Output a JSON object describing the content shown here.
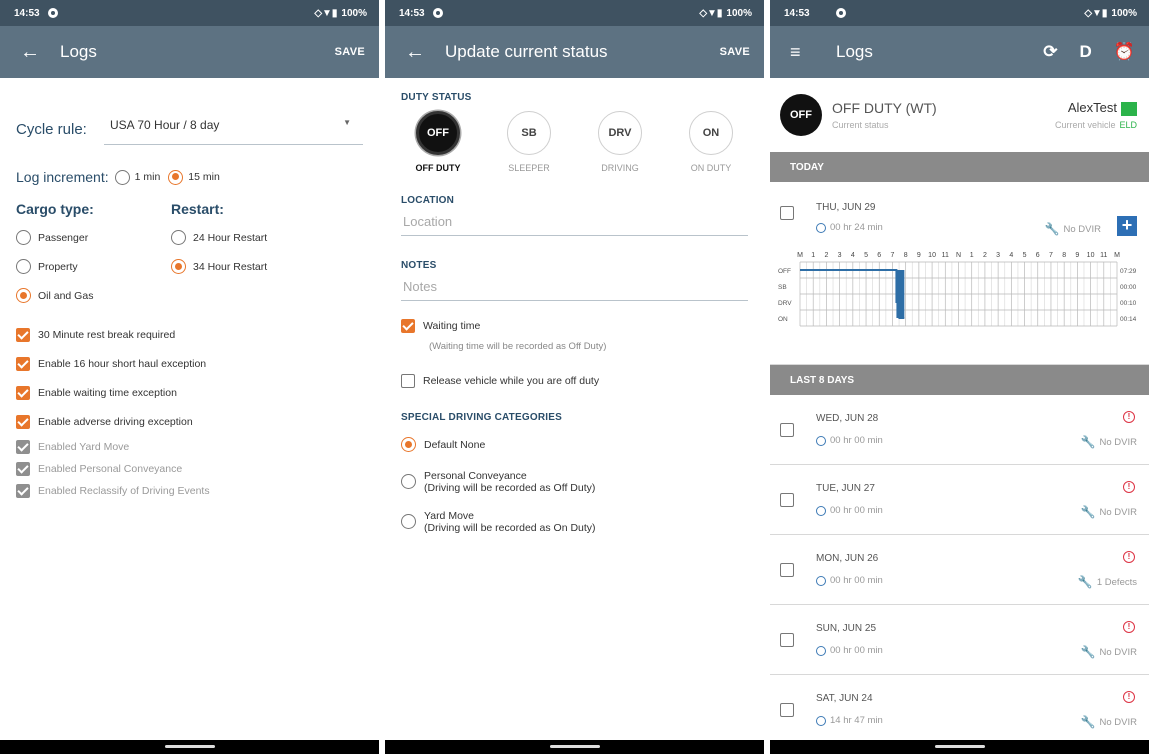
{
  "statusbar": {
    "time": "14:53",
    "battery": "100%"
  },
  "s1": {
    "title": "Logs",
    "save": "SAVE",
    "cycle_label": "Cycle rule:",
    "cycle_value": "USA 70 Hour / 8 day",
    "inc_label": "Log increment:",
    "inc_options": [
      "1 min",
      "15 min"
    ],
    "cargo_label": "Cargo type:",
    "cargo_options": [
      "Passenger",
      "Property",
      "Oil and Gas"
    ],
    "restart_label": "Restart:",
    "restart_options": [
      "24 Hour Restart",
      "34 Hour Restart"
    ],
    "checks": [
      "30 Minute rest break required",
      "Enable 16 hour short haul exception",
      "Enable waiting time exception",
      "Enable adverse driving exception"
    ],
    "disabled": [
      "Enabled Yard Move",
      "Enabled Personal Conveyance",
      "Enabled Reclassify of Driving Events"
    ]
  },
  "s2": {
    "title": "Update current status",
    "save": "SAVE",
    "duty_header": "DUTY STATUS",
    "duty": [
      {
        "abbr": "OFF",
        "label": "OFF DUTY"
      },
      {
        "abbr": "SB",
        "label": "SLEEPER"
      },
      {
        "abbr": "DRV",
        "label": "DRIVING"
      },
      {
        "abbr": "ON",
        "label": "ON DUTY"
      }
    ],
    "location_header": "LOCATION",
    "location_placeholder": "Location",
    "notes_header": "NOTES",
    "notes_placeholder": "Notes",
    "waiting": "Waiting time",
    "waiting_note": "(Waiting time will be recorded as Off Duty)",
    "release": "Release vehicle while you are off duty",
    "sdc_header": "SPECIAL DRIVING CATEGORIES",
    "sdc": [
      {
        "l1": "Default None",
        "l2": ""
      },
      {
        "l1": "Personal Conveyance",
        "l2": "(Driving will be recorded as Off Duty)"
      },
      {
        "l1": "Yard Move",
        "l2": "(Driving will be recorded as On Duty)"
      }
    ]
  },
  "s3": {
    "title": "Logs",
    "d_icon": "D",
    "status_main": "OFF DUTY (WT)",
    "status_sub": "Current status",
    "badge": "OFF",
    "vehicle": "AlexTest",
    "vehicle_sub": "Current vehicle",
    "eld": "ELD",
    "today": "TODAY",
    "last": "LAST 8 DAYS",
    "today_day": {
      "name": "THU, JUN 29",
      "dur": "00 hr 24 min",
      "dvir": "No DVIR"
    },
    "grid_hours": [
      "M",
      "1",
      "2",
      "3",
      "4",
      "5",
      "6",
      "7",
      "8",
      "9",
      "10",
      "11",
      "N",
      "1",
      "2",
      "3",
      "4",
      "5",
      "6",
      "7",
      "8",
      "9",
      "10",
      "11",
      "M"
    ],
    "grid_rows": [
      "OFF",
      "SB",
      "DRV",
      "ON"
    ],
    "grid_totals": [
      "07:29",
      "00:00",
      "00:10",
      "00:14"
    ],
    "days": [
      {
        "name": "WED, JUN 28",
        "dur": "00 hr 00 min",
        "dvir": "No DVIR"
      },
      {
        "name": "TUE, JUN 27",
        "dur": "00 hr 00 min",
        "dvir": "No DVIR"
      },
      {
        "name": "MON, JUN 26",
        "dur": "00 hr 00 min",
        "dvir": "1 Defects"
      },
      {
        "name": "SUN, JUN 25",
        "dur": "00 hr 00 min",
        "dvir": "No DVIR"
      },
      {
        "name": "SAT, JUN 24",
        "dur": "14 hr 47 min",
        "dvir": "No DVIR"
      }
    ]
  }
}
